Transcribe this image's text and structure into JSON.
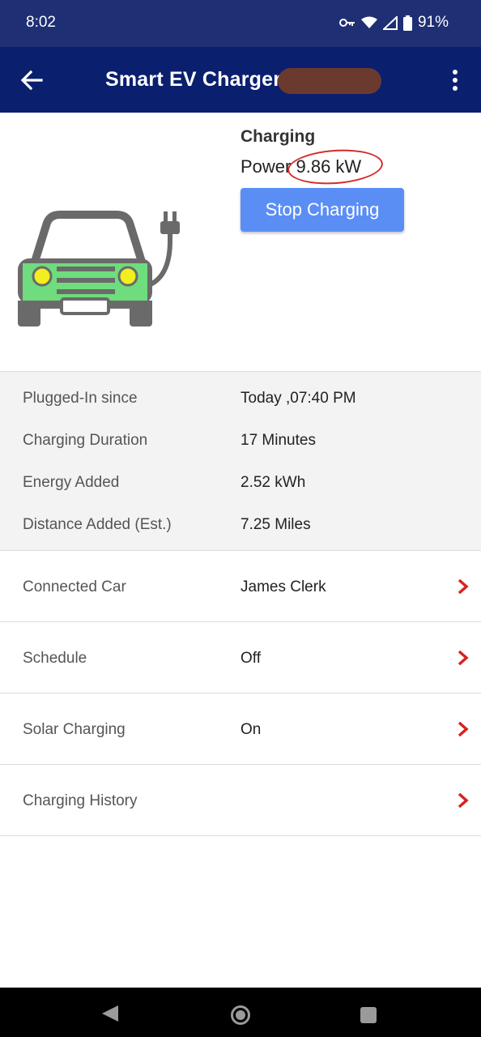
{
  "status_bar": {
    "time": "8:02",
    "battery": "91%",
    "icons": [
      "vpn-key-icon",
      "wifi-icon",
      "signal-icon",
      "battery-icon"
    ]
  },
  "app_bar": {
    "title": "Smart EV Charger",
    "back_icon": "arrow-left-icon",
    "menu_icon": "more-vert-icon"
  },
  "charger": {
    "status": "Charging",
    "power_label": "Power",
    "power_value": "9.86 kW",
    "stop_button": "Stop Charging",
    "car_icon": "car-charging-icon"
  },
  "info": [
    {
      "label": "Plugged-In since",
      "value": "Today ,07:40 PM"
    },
    {
      "label": "Charging Duration",
      "value": "17 Minutes"
    },
    {
      "label": "Energy Added",
      "value": "2.52 kWh"
    },
    {
      "label": "Distance Added (Est.)",
      "value": "7.25 Miles"
    }
  ],
  "nav_items": [
    {
      "label": "Connected Car",
      "value": "James Clerk"
    },
    {
      "label": "Schedule",
      "value": "Off"
    },
    {
      "label": "Solar Charging",
      "value": "On"
    },
    {
      "label": "Charging History",
      "value": ""
    }
  ],
  "colors": {
    "status_bar": "#1f2f74",
    "app_bar": "#0a1f6e",
    "button": "#5b8ef5",
    "chevron": "#d62222",
    "car_body": "#6a6a6a",
    "car_green": "#6fdc7d",
    "headlight": "#f2ee20"
  },
  "system_nav": [
    "back-icon",
    "home-icon",
    "recents-icon"
  ]
}
